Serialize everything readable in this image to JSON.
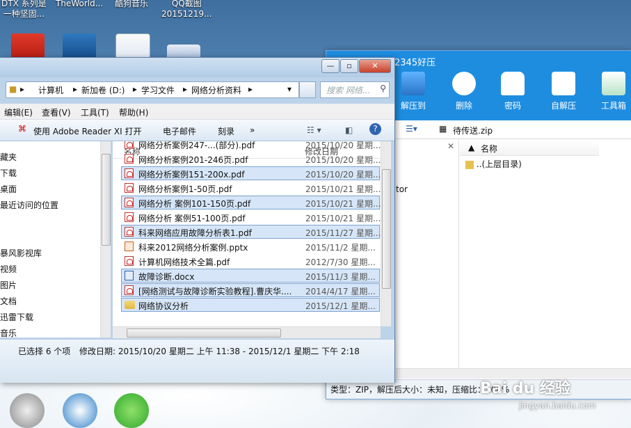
{
  "desktop": {
    "labels": [
      {
        "l1": "DTX 系列是",
        "l2": "一种坚固..."
      },
      {
        "l1": "TheWorld...",
        "l2": ""
      },
      {
        "l1": "酷狗音乐",
        "l2": ""
      },
      {
        "l1": "QQ截图",
        "l2": "20151219..."
      }
    ]
  },
  "zip": {
    "title": "2345好压",
    "tools": [
      "解压到",
      "删除",
      "密码",
      "自解压",
      "工具箱"
    ],
    "archive_name": "待传送.zip",
    "column_name": "名称",
    "parent_dir": "..(上层目录)",
    "left_text": "tor",
    "status": "类型：ZIP，解压后大小：未知，压缩比：100%"
  },
  "explorer": {
    "breadcrumb": [
      "计算机",
      "新加卷 (D:)",
      "学习文件",
      "网络分析资料"
    ],
    "search_placeholder": "搜索 网络...",
    "menu": [
      "编辑(E)",
      "查看(V)",
      "工具(T)",
      "帮助(H)"
    ],
    "commands": {
      "open": "使用 Adobe Reader XI 打开",
      "email": "电子邮件",
      "burn": "刻录",
      "more": "»"
    },
    "nav_items": [
      "藏夹",
      "下载",
      "桌面",
      "最近访问的位置",
      "暴风影视库",
      "视频",
      "图片",
      "文档",
      "迅雷下载",
      "音乐"
    ],
    "columns": {
      "name": "名称",
      "date": "修改日期"
    },
    "files": [
      {
        "name": "网络分析案例247-...(部分).pdf",
        "date": "2015/10/20 星期...",
        "type": "pdf",
        "selected": false
      },
      {
        "name": "网络分析案例201-246页.pdf",
        "date": "2015/10/20 星期...",
        "type": "pdf",
        "selected": false
      },
      {
        "name": "网络分析案例151-200x.pdf",
        "date": "2015/10/20 星期...",
        "type": "pdf",
        "selected": true
      },
      {
        "name": "网络分析案例1-50页.pdf",
        "date": "2015/10/21 星期...",
        "type": "pdf",
        "selected": false
      },
      {
        "name": "网络分析 案例101-150页.pdf",
        "date": "2015/10/21 星期...",
        "type": "pdf",
        "selected": true
      },
      {
        "name": "网络分析 案例51-100页.pdf",
        "date": "2015/10/21 星期...",
        "type": "pdf",
        "selected": false
      },
      {
        "name": "科来网络应用故障分析表1.pdf",
        "date": "2015/11/27 星期...",
        "type": "pdf",
        "selected": true
      },
      {
        "name": "科来2012网络分析案例.pptx",
        "date": "2015/11/2 星期...",
        "type": "ppt",
        "selected": false
      },
      {
        "name": "计算机网络技术全篇.pdf",
        "date": "2012/7/30 星期...",
        "type": "pdf",
        "selected": false
      },
      {
        "name": "故障诊断.docx",
        "date": "2015/11/3 星期...",
        "type": "doc",
        "selected": true
      },
      {
        "name": "[网络测试与故障诊断实验教程].曹庆华....",
        "date": "2014/4/17 星期...",
        "type": "pdf",
        "selected": true
      },
      {
        "name": "网络协议分析",
        "date": "2015/12/1 星期...",
        "type": "folder",
        "selected": true
      }
    ],
    "details": {
      "count": "已选择 6 个项",
      "dates": "修改日期: 2015/10/20 星期二 上午 11:38 - 2015/12/1 星期二 下午 2:18"
    }
  },
  "watermark": {
    "brand": "Bai du 经验",
    "url": "jingyan.baidu.com"
  }
}
